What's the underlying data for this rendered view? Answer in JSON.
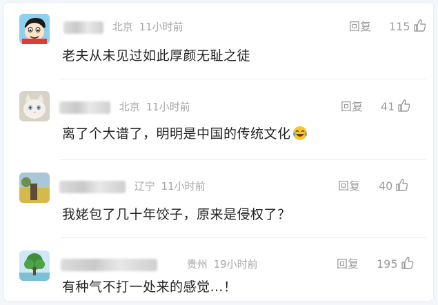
{
  "comments": [
    {
      "location": "北京",
      "time": "11小时前",
      "reply_label": "回复",
      "likes": "115",
      "text": "老夫从未见过如此厚颜无耻之徒",
      "avatar_icon": "cartoon-boy-avatar"
    },
    {
      "location": "北京",
      "time": "11小时前",
      "reply_label": "回复",
      "likes": "41",
      "text": "离了个大谱了，明明是中国的传统文化",
      "avatar_icon": "cat-avatar",
      "trailing_emoji": "laughing-crying-emoji"
    },
    {
      "location": "辽宁",
      "time": "11小时前",
      "reply_label": "回复",
      "likes": "40",
      "text": "我姥包了几十年饺子，原来是侵权了？",
      "avatar_icon": "landscape-avatar"
    },
    {
      "location": "贵州",
      "time": "19小时前",
      "reply_label": "回复",
      "likes": "195",
      "text": "有种气不打一处来的感觉…！",
      "avatar_icon": "tree-avatar"
    }
  ]
}
